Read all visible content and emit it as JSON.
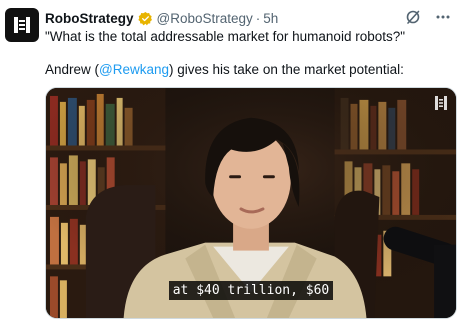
{
  "author": {
    "name": "RoboStrategy",
    "handle": "@RoboStrategy",
    "separator": "·",
    "time": "5h",
    "avatar_icon": "robostrategy-logo-icon",
    "verified_color": "#e8b400"
  },
  "text": {
    "line1": "\"What is the total addressable market for humanoid robots?\"",
    "line2_pre": "Andrew (",
    "mention": "@Rewkang",
    "line2_post": ") gives his take on the market potential:"
  },
  "media": {
    "caption": "at $40 trillion, $60",
    "watermark_icon": "robostrategy-watermark-icon"
  },
  "icons": {
    "grok": "grok-icon",
    "more": "more-options-icon"
  },
  "colors": {
    "link": "#1d9bf0",
    "muted": "#536471"
  }
}
